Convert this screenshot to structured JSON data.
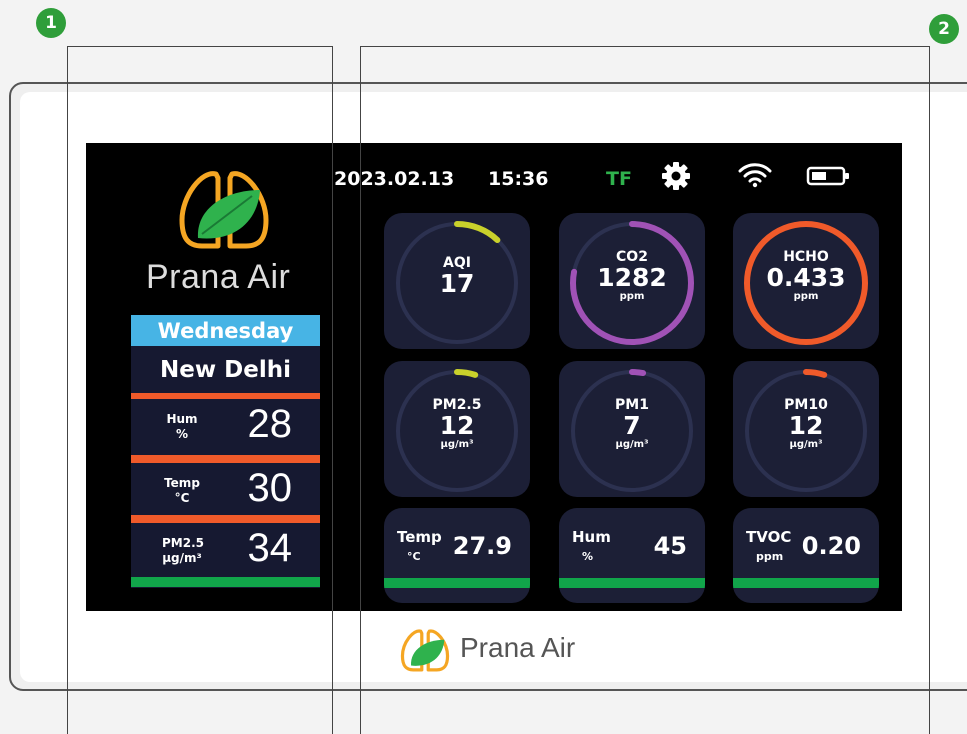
{
  "badges": {
    "left": "1",
    "right": "2"
  },
  "status": {
    "date": "2023.02.13",
    "time": "15:36",
    "tf": "TF",
    "icons": [
      "gear-icon",
      "wifi-icon",
      "battery-icon"
    ]
  },
  "brand": {
    "name": "Prana Air"
  },
  "left_panel": {
    "day": "Wednesday",
    "city": "New Delhi",
    "rows": [
      {
        "label": "Hum",
        "unit": "%",
        "value": "28"
      },
      {
        "label": "Temp",
        "unit": "°C",
        "value": "30"
      },
      {
        "label": "PM2.5",
        "unit": "µg/m³",
        "value": "34"
      }
    ]
  },
  "gauges": [
    {
      "name": "AQI",
      "value": "17",
      "unit": "",
      "color": "#c9d12b",
      "level": 0.12
    },
    {
      "name": "CO2",
      "value": "1282",
      "unit": "ppm",
      "color": "#a052b6",
      "level": 0.78
    },
    {
      "name": "HCHO",
      "value": "0.433",
      "unit": "ppm",
      "color": "#f05a2a",
      "level": 1.0
    },
    {
      "name": "PM2.5",
      "value": "12",
      "unit": "µg/m³",
      "color": "#c9d12b",
      "level": 0.05
    },
    {
      "name": "PM1",
      "value": "7",
      "unit": "µg/m³",
      "color": "#a052b6",
      "level": 0.03
    },
    {
      "name": "PM10",
      "value": "12",
      "unit": "µg/m³",
      "color": "#f05a2a",
      "level": 0.05
    }
  ],
  "bottom_cards": [
    {
      "name": "Temp",
      "unit": "°C",
      "value": "27.9"
    },
    {
      "name": "Hum",
      "unit": "%",
      "value": "45"
    },
    {
      "name": "TVOC",
      "unit": "ppm",
      "value": "0.20"
    }
  ],
  "colors": {
    "panel": "#161931",
    "card": "#1c1f36",
    "accent_green": "#11a54a",
    "accent_red": "#f05a2a",
    "day_bg": "#47b4e5"
  }
}
